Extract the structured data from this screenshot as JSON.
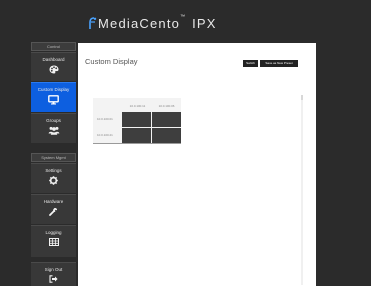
{
  "header": {
    "brand": "MediaCento",
    "tm": "™",
    "suffix": " IPX"
  },
  "sidebar": {
    "section_control": "Control",
    "section_system": "System Mgmt",
    "items": [
      {
        "id": "dashboard",
        "label": "Dashboard",
        "icon": "palette-icon",
        "active": false
      },
      {
        "id": "custom-display",
        "label": "Custom Display",
        "icon": "monitor-icon",
        "active": true
      },
      {
        "id": "groups",
        "label": "Groups",
        "icon": "users-icon",
        "active": false
      },
      {
        "id": "settings",
        "label": "Settings",
        "icon": "gear-icon",
        "active": false
      },
      {
        "id": "hardware",
        "label": "Hardware",
        "icon": "wrench-icon",
        "active": false
      },
      {
        "id": "logging",
        "label": "Logging",
        "icon": "table-icon",
        "active": false
      },
      {
        "id": "sign-out",
        "label": "Sign Out",
        "icon": "sign-out-icon",
        "active": false
      }
    ]
  },
  "main": {
    "title": "Custom Display",
    "switch_label": "Switch",
    "save_label": "Save as New Preset"
  },
  "grid": {
    "columns": [
      "10.0.100.11",
      "10.0.100.06"
    ],
    "rows": [
      "10.0.100.01",
      "10.0.100.21"
    ]
  },
  "colors": {
    "accent": "#0d5fe0",
    "background": "#2b2b2b",
    "sidebar_item": "#383838",
    "cell": "#3e3e3e"
  }
}
